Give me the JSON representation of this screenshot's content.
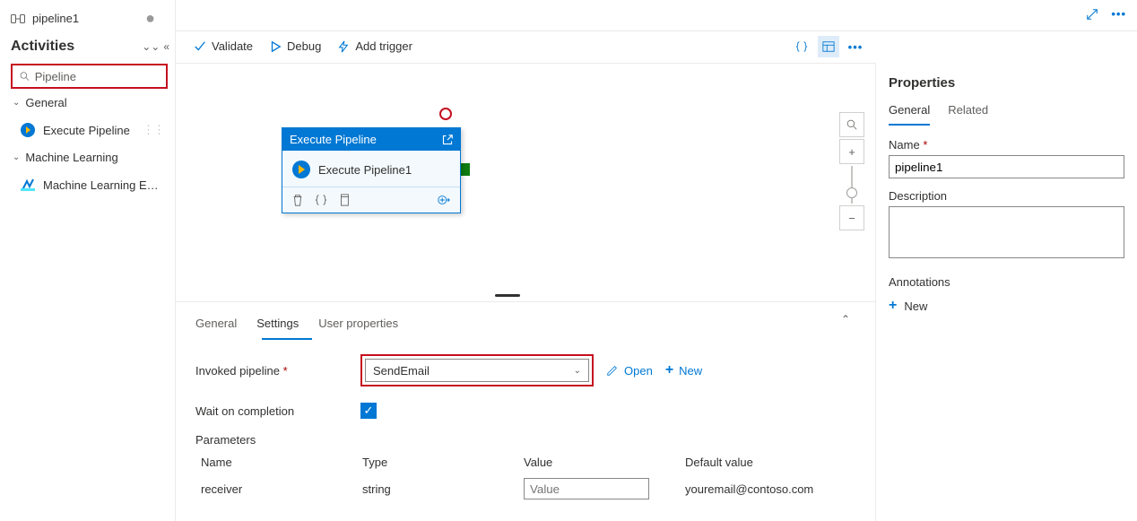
{
  "sidebar": {
    "pipeline_name": "pipeline1",
    "section_title": "Activities",
    "search_value": "Pipeline",
    "categories": [
      {
        "label": "General",
        "items": [
          {
            "label": "Execute Pipeline"
          }
        ]
      },
      {
        "label": "Machine Learning",
        "items": [
          {
            "label": "Machine Learning Exe..."
          }
        ]
      }
    ]
  },
  "toolbar": {
    "validate": "Validate",
    "debug": "Debug",
    "add_trigger": "Add trigger"
  },
  "canvas": {
    "node": {
      "header": "Execute Pipeline",
      "title": "Execute Pipeline1"
    }
  },
  "bottom": {
    "tabs": {
      "general": "General",
      "settings": "Settings",
      "userprops": "User properties"
    },
    "invoked_label": "Invoked pipeline",
    "invoked_value": "SendEmail",
    "open": "Open",
    "new": "New",
    "wait_label": "Wait on completion",
    "params_title": "Parameters",
    "headers": {
      "name": "Name",
      "type": "Type",
      "value": "Value",
      "default": "Default value"
    },
    "row": {
      "name": "receiver",
      "type": "string",
      "value_placeholder": "Value",
      "default": "youremail@contoso.com"
    }
  },
  "rpanel": {
    "title": "Properties",
    "tabs": {
      "general": "General",
      "related": "Related"
    },
    "name_label": "Name",
    "name_value": "pipeline1",
    "desc_label": "Description",
    "annotations_label": "Annotations",
    "new": "New"
  }
}
